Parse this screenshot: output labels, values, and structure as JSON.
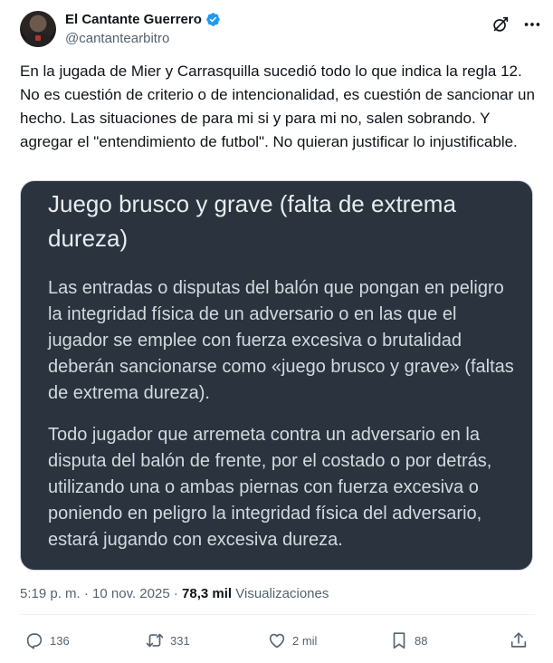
{
  "author": {
    "display_name": "El Cantante Guerrero",
    "handle": "@cantantearbitro",
    "verified": true
  },
  "tweet": {
    "text": "En la jugada de Mier y Carrasquilla sucedió todo lo que indica la regla 12. No es cuestión de criterio o de intencionalidad, es cuestión de sancionar un hecho. Las situaciones de para mi si y para mi no, salen sobrando. Y agregar el \"entendimiento de futbol\". No quieran justificar lo injustificable."
  },
  "media": {
    "title": "Juego brusco y grave (falta de extrema dureza)",
    "paragraph_1": "Las entradas o disputas del balón que pongan en peligro la integridad física de un adversario o en las que el jugador se emplee con fuerza excesiva o brutalidad deberán sancionarse como «juego brusco y grave» (faltas de extrema dureza).",
    "paragraph_2": "Todo jugador que arremeta contra un adversario en la disputa del balón de frente, por el costado o por detrás, utilizando una o ambas piernas con fuerza excesiva o poniendo en peligro la integridad física del adversario, estará jugando con excesiva dureza."
  },
  "meta": {
    "time": "5:19 p. m.",
    "separator": "·",
    "date": "10 nov. 2025",
    "views_count": "78,3 mil",
    "views_label": "Visualizaciones"
  },
  "actions": {
    "replies": "136",
    "retweets": "331",
    "likes": "2 mil",
    "bookmarks": "88"
  },
  "colors": {
    "verified": "#1d9bf0",
    "secondary_text": "#536471",
    "media_background": "#2a333e"
  },
  "icons": [
    "verified-icon",
    "grok-icon",
    "more-icon",
    "reply-icon",
    "retweet-icon",
    "like-icon",
    "bookmark-icon",
    "share-icon"
  ]
}
